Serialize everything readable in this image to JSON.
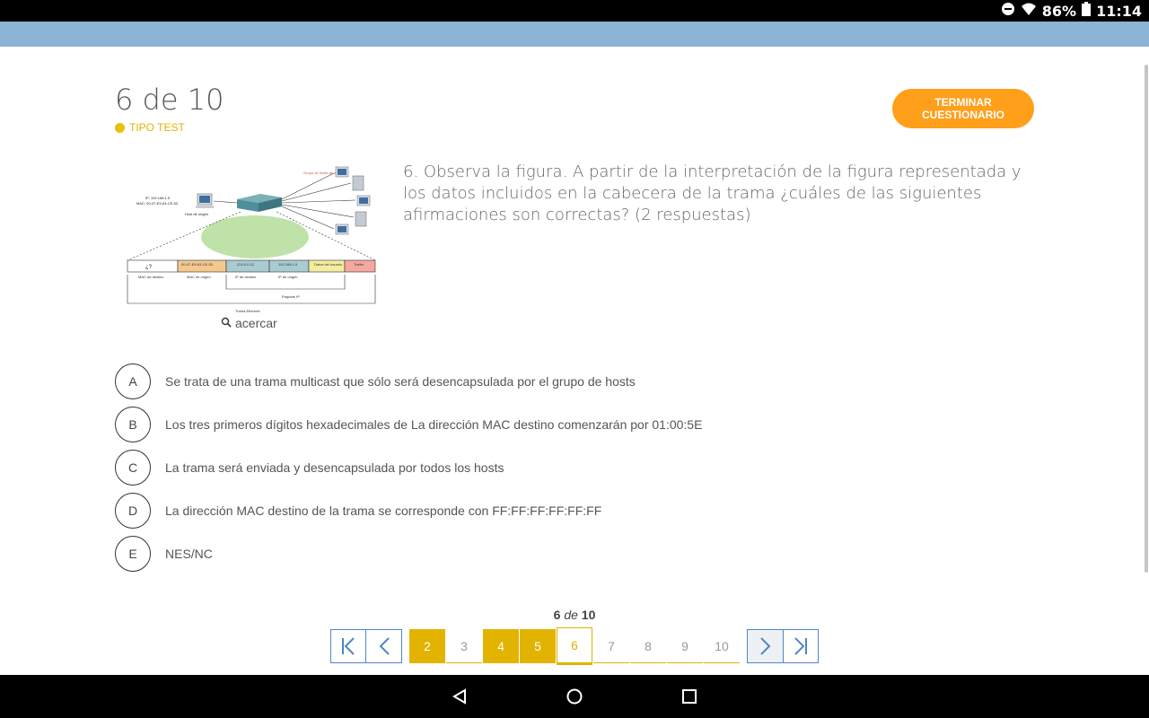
{
  "status": {
    "battery": "86%",
    "time": "11:14"
  },
  "header": {
    "count": "6 de 10",
    "type_label": "TIPO TEST",
    "finish_label": "TERMINAR CUESTIONARIO"
  },
  "figure": {
    "zoom_label": "acercar",
    "labels": {
      "hosts_group": "Grupo de hosts de destino",
      "ip": "IP: 192.168.1.5",
      "mac": "MAC: 00-07-E9-63-CE-53",
      "source_host": "Host de origen",
      "cells": [
        "¿?",
        "00-07-E9-63-CE-53",
        "224.0.0.12",
        "192.168.1.5",
        "Datos del usuario",
        "Tráiler"
      ],
      "fields": [
        "MAC de destino",
        "MAC de origen",
        "IP de destino",
        "IP de origen"
      ],
      "packet": "Paquete IP",
      "frame": "Trama Ethernet"
    }
  },
  "question": {
    "text": "6. Observa la figura. A partir de la interpretación de la figura representada y los datos incluidos en la cabecera de la trama ¿cuáles de las siguientes afirmaciones son correctas? (2 respuestas)"
  },
  "options": [
    {
      "letter": "A",
      "text": "Se trata de una trama multicast que sólo será desencapsulada por el grupo de hosts"
    },
    {
      "letter": "B",
      "text": "Los tres primeros dígitos hexadecimales de La dirección MAC destino comenzarán por 01:00:5E"
    },
    {
      "letter": "C",
      "text": "La trama será enviada y desencapsulada por todos los hosts"
    },
    {
      "letter": "D",
      "text": "La dirección MAC destino de la trama se corresponde con FF:FF:FF:FF:FF:FF"
    },
    {
      "letter": "E",
      "text": "NES/NC"
    }
  ],
  "pager": {
    "current": "6",
    "of": "de",
    "total": "10",
    "pages": [
      "2",
      "3",
      "4",
      "5",
      "6",
      "7",
      "8",
      "9",
      "10"
    ]
  },
  "colors": {
    "accent": "#e2b300",
    "finish": "#ff9f1a",
    "nav": "#4f86c6",
    "appbar": "#8db3d6"
  }
}
